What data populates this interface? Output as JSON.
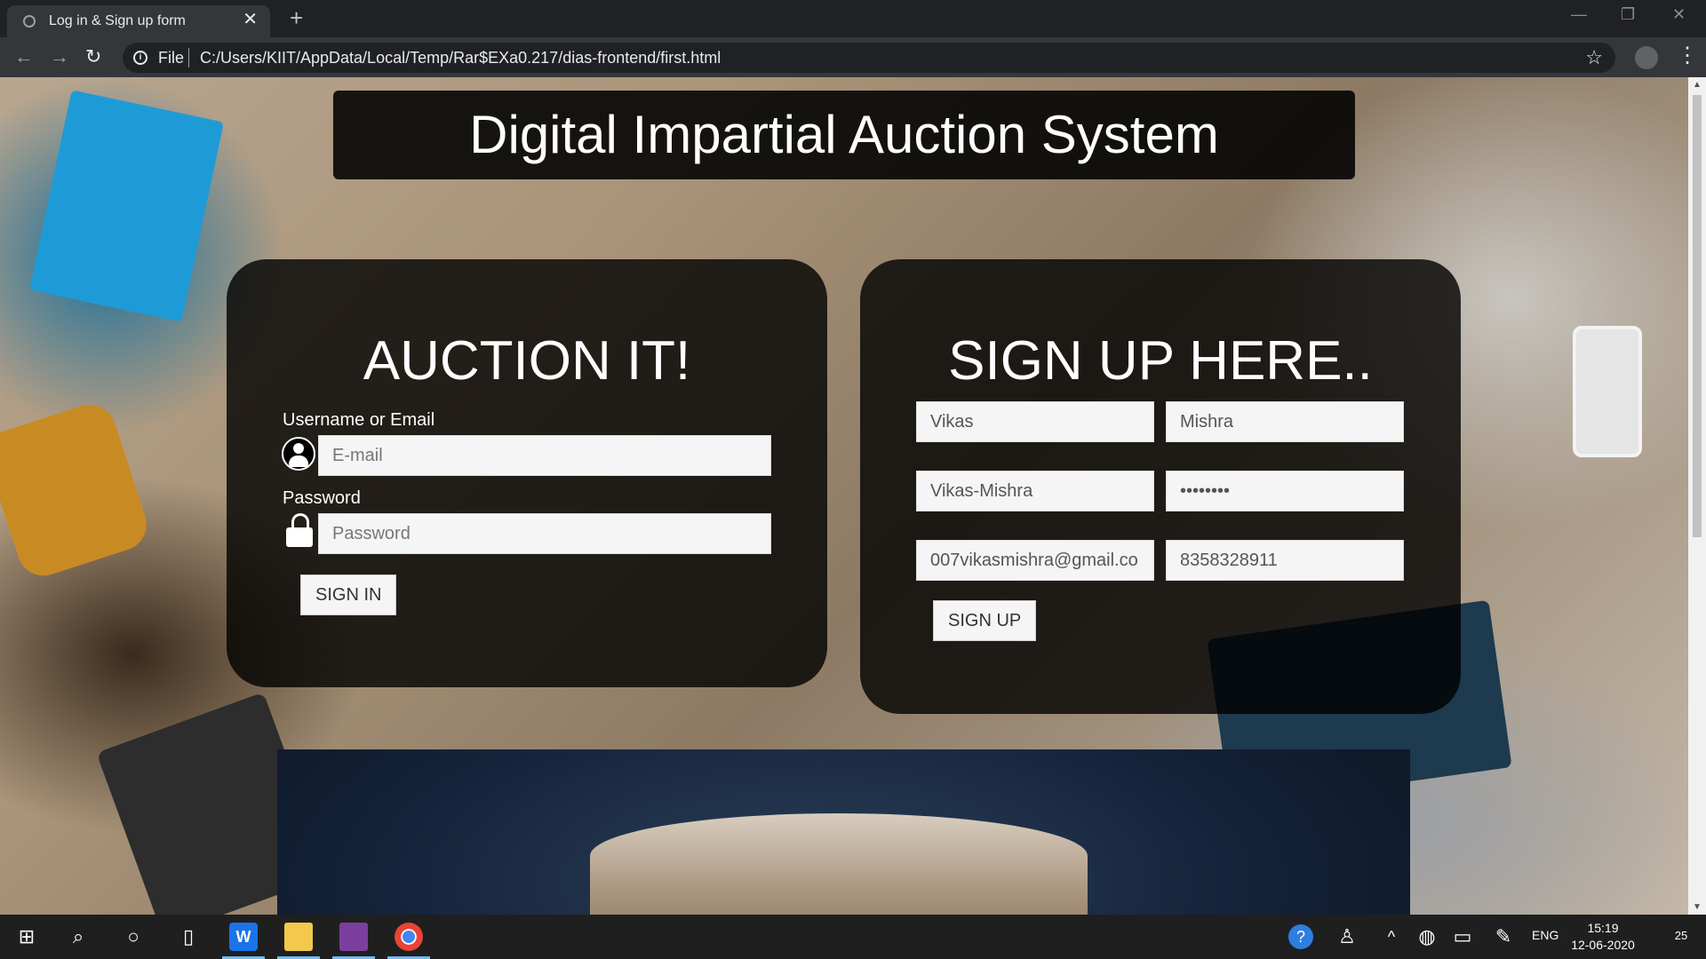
{
  "browser": {
    "tab_title": "Log in & Sign up form",
    "new_tab_symbol": "+",
    "close_symbol": "✕",
    "url_scheme": "File",
    "url": "C:/Users/KIIT/AppData/Local/Temp/Rar$EXa0.217/dias-frontend/first.html"
  },
  "page": {
    "heading": "Digital Impartial Auction System"
  },
  "login": {
    "title": "AUCTION IT!",
    "username_label": "Username or Email",
    "email_placeholder": "E-mail",
    "password_label": "Password",
    "password_placeholder": "Password",
    "sign_in_label": "SIGN IN"
  },
  "signup": {
    "title": "SIGN UP HERE..",
    "first_name_value": "Vikas",
    "last_name_value": "Mishra",
    "username_value": "Vikas-Mishra",
    "password_value": "••••••••",
    "email_value": "007vikasmishra@gmail.co",
    "phone_value": "8358328911",
    "sign_up_label": "SIGN UP"
  },
  "taskbar": {
    "language": "ENG",
    "time": "15:19",
    "date": "12-06-2020",
    "notification_count": "25",
    "icons": [
      "windows-start-icon",
      "search-icon",
      "cortana-icon",
      "task-view-icon",
      "word-icon",
      "file-explorer-icon",
      "winrar-icon",
      "chrome-icon"
    ]
  },
  "colors": {
    "panel_bg": "rgba(0,0,0,0.8)",
    "chrome_dark": "#202124",
    "chrome_toolbar": "#35363a",
    "taskbar": "#1f1f1f"
  }
}
